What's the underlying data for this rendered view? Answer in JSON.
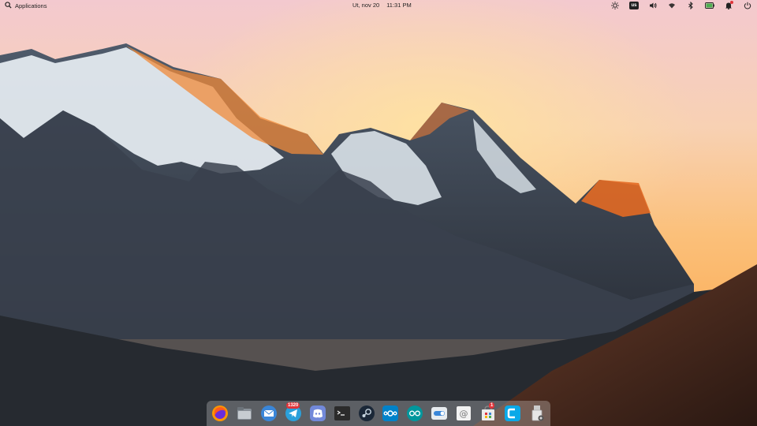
{
  "panel": {
    "applications_label": "Applications",
    "date": "Ut, nov 20",
    "time": "11:31 PM",
    "keyboard_layout": "us"
  },
  "indicators": [
    "night-light-icon",
    "keyboard-layout",
    "volume-icon",
    "wifi-icon",
    "bluetooth-icon",
    "battery-icon",
    "notifications-icon",
    "power-icon"
  ],
  "dock": {
    "items": [
      {
        "name": "firefox"
      },
      {
        "name": "files"
      },
      {
        "name": "mail"
      },
      {
        "name": "telegram",
        "badge": "1320"
      },
      {
        "name": "discord"
      },
      {
        "name": "terminal"
      },
      {
        "name": "steam"
      },
      {
        "name": "nextcloud"
      },
      {
        "name": "arduino"
      },
      {
        "name": "settings-switchboard"
      },
      {
        "name": "mail-composer"
      },
      {
        "name": "appcenter",
        "badge": "1"
      },
      {
        "name": "code-editor"
      },
      {
        "name": "installer"
      }
    ]
  }
}
